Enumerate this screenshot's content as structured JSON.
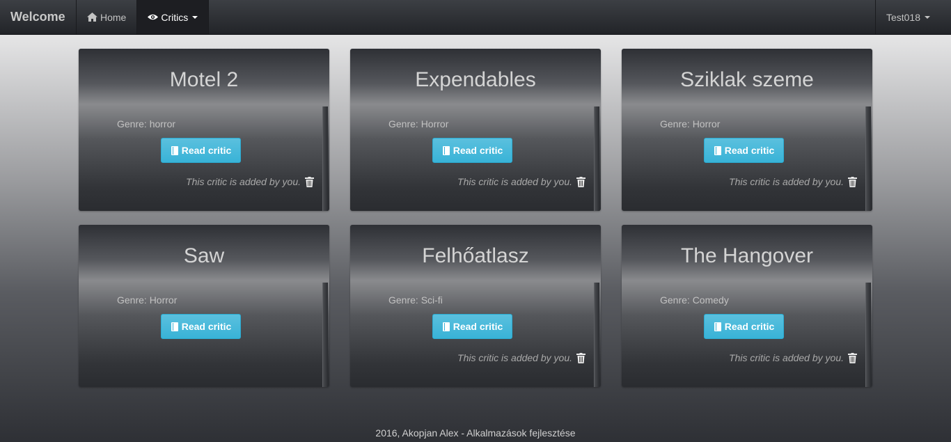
{
  "navbar": {
    "brand": "Welcome",
    "home_label": "Home",
    "critics_label": "Critics",
    "user_label": "Test018"
  },
  "cards": [
    {
      "title": "Motel 2",
      "genre": "Genre: horror",
      "button": "Read critic",
      "added_note": "This critic is added by you."
    },
    {
      "title": "Expendables",
      "genre": "Genre: Horror",
      "button": "Read critic",
      "added_note": "This critic is added by you."
    },
    {
      "title": "Sziklak szeme",
      "genre": "Genre: Horror",
      "button": "Read critic",
      "added_note": "This critic is added by you."
    },
    {
      "title": "Saw",
      "genre": "Genre: Horror",
      "button": "Read critic",
      "added_note": ""
    },
    {
      "title": "Felhőatlasz",
      "genre": "Genre: Sci-fi",
      "button": "Read critic",
      "added_note": "This critic is added by you."
    },
    {
      "title": "The Hangover",
      "genre": "Genre: Comedy",
      "button": "Read critic",
      "added_note": "This critic is added by you."
    }
  ],
  "footer": {
    "text": "2016, Akopjan Alex - Alkalmazások fejlesztése"
  },
  "colors": {
    "button": "#5bc0de",
    "navbar": "#2e3035"
  },
  "icons": {
    "home": "home-icon",
    "critics": "eye-icon",
    "read": "book-icon",
    "delete": "trash-icon"
  }
}
